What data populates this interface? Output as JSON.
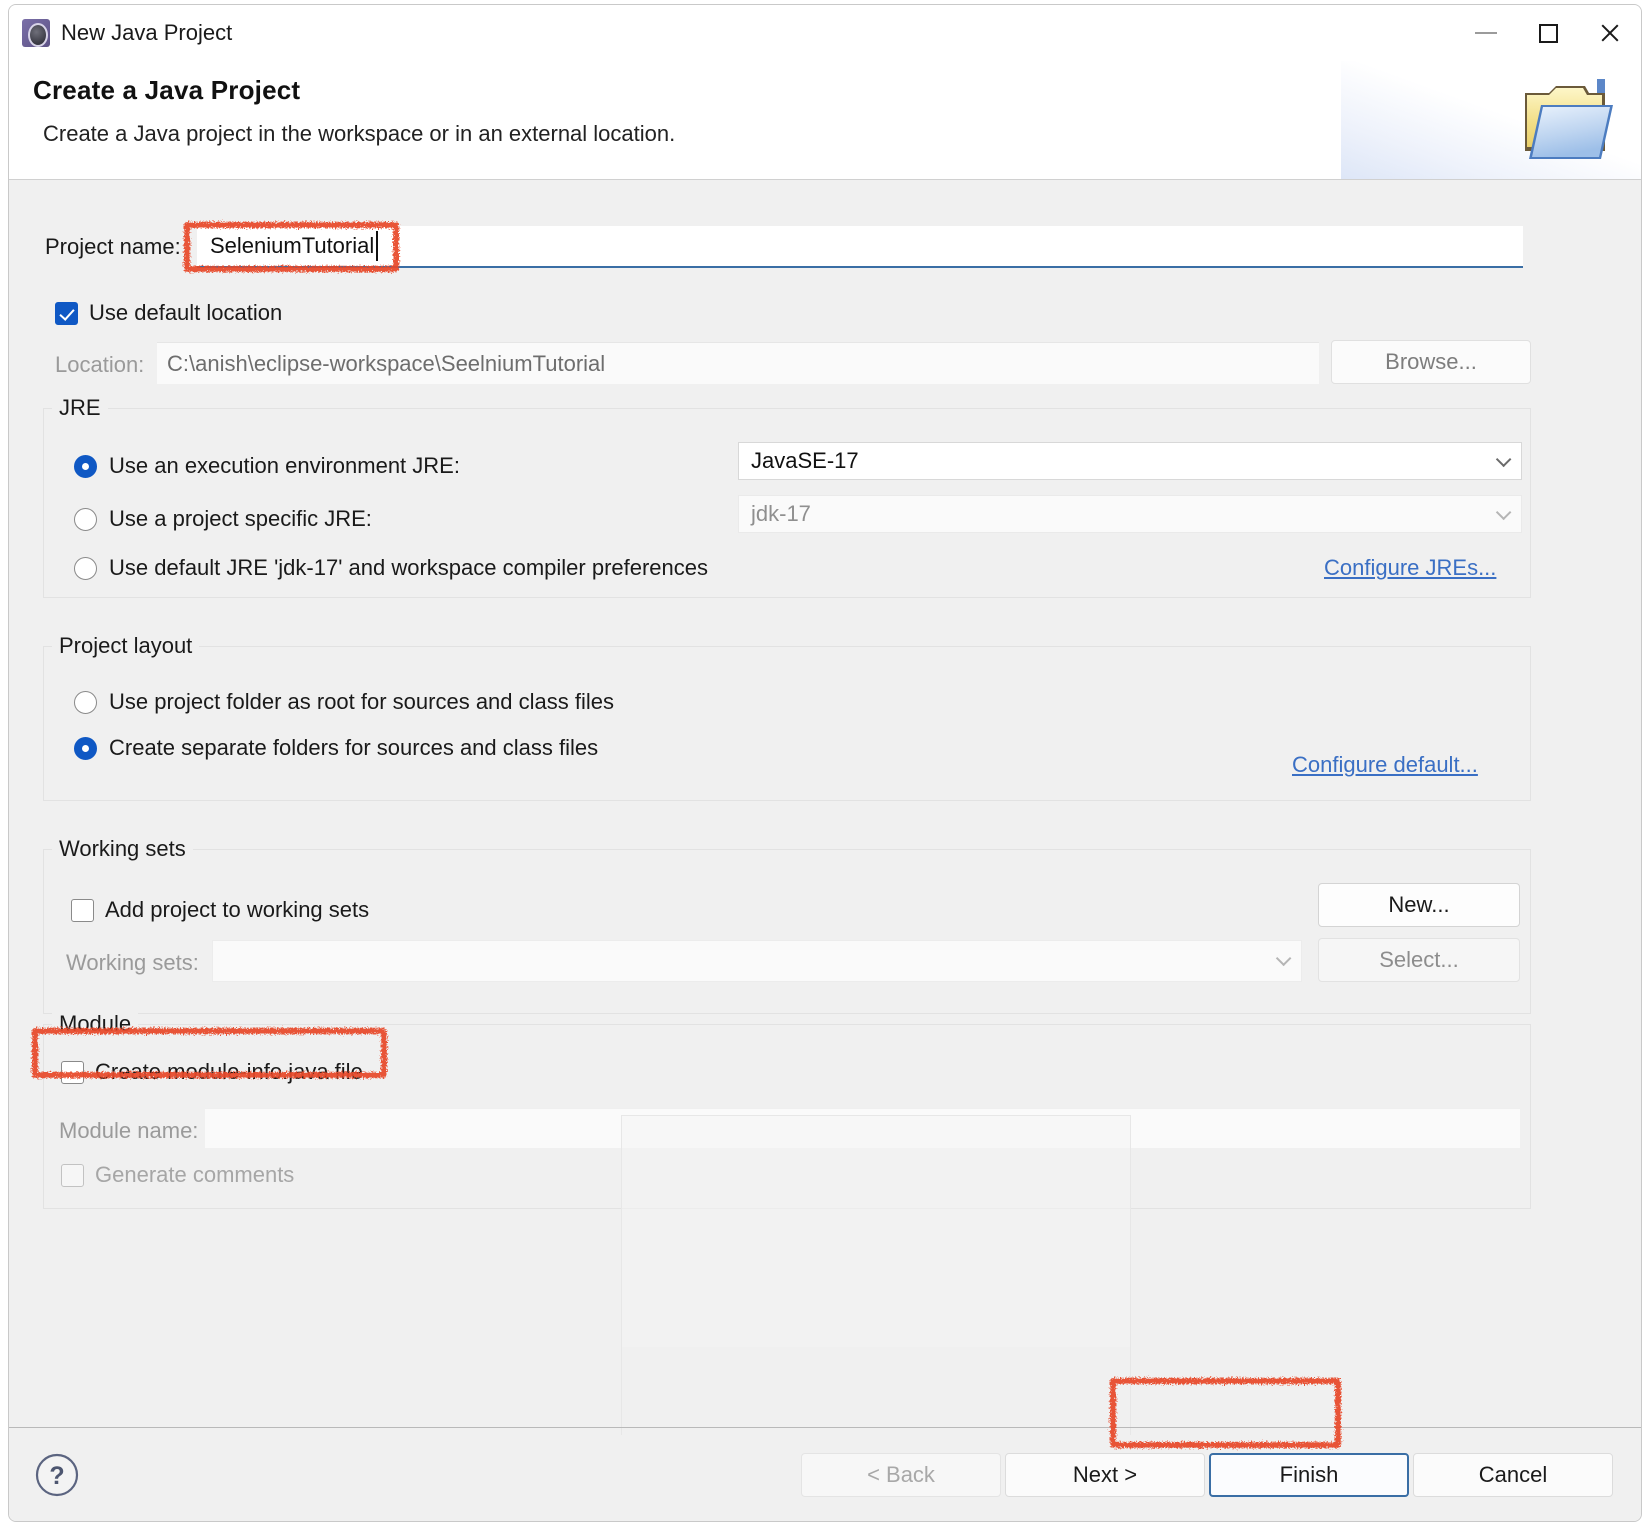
{
  "window": {
    "title": "New Java Project",
    "app_icon": "eclipse-icon",
    "controls": {
      "minimize": "minimize-icon",
      "maximize": "maximize-icon",
      "close": "close-icon"
    }
  },
  "banner": {
    "heading": "Create a Java Project",
    "subtitle": "Create a Java project in the workspace or in an external location.",
    "art_icon": "folder-icon"
  },
  "form": {
    "project_name": {
      "label": "Project name:",
      "value": "SeleniumTutorial",
      "placeholder": ""
    },
    "use_default_location": {
      "label": "Use default location",
      "checked": true
    },
    "location": {
      "label": "Location:",
      "value": "C:\\anish\\eclipse-workspace\\SeelniumTutorial",
      "browse_label": "Browse..."
    }
  },
  "jre": {
    "group_title": "JRE",
    "options": [
      {
        "label": "Use an execution environment JRE:",
        "selected": true
      },
      {
        "label": "Use a project specific JRE:",
        "selected": false
      },
      {
        "label": "Use default JRE 'jdk-17' and workspace compiler preferences",
        "selected": false
      }
    ],
    "execution_env_value": "JavaSE-17",
    "project_jre_value": "jdk-17",
    "configure_link": "Configure JREs..."
  },
  "project_layout": {
    "group_title": "Project layout",
    "options": [
      {
        "label": "Use project folder as root for sources and class files",
        "selected": false
      },
      {
        "label": "Create separate folders for sources and class files",
        "selected": true
      }
    ],
    "configure_link": "Configure default..."
  },
  "working_sets": {
    "group_title": "Working sets",
    "add_checkbox": {
      "label": "Add project to working sets",
      "checked": false
    },
    "new_button": "New...",
    "sets_label": "Working sets:",
    "sets_value": "",
    "select_button": "Select..."
  },
  "module": {
    "group_title": "Module",
    "create_info": {
      "label": "Create module-info.java file",
      "checked": false
    },
    "module_name_label": "Module name:",
    "module_name_value": "",
    "generate_comments": {
      "label": "Generate comments",
      "checked": false
    }
  },
  "footer": {
    "help_icon": "help-icon",
    "buttons": [
      {
        "label": "< Back",
        "state": "disabled"
      },
      {
        "label": "Next >",
        "state": "enabled"
      },
      {
        "label": "Finish",
        "state": "default"
      },
      {
        "label": "Cancel",
        "state": "enabled"
      }
    ]
  },
  "annotations": {
    "color": "#e8492a",
    "targets": [
      "project-name-field",
      "create-module-info-checkbox",
      "finish-button"
    ]
  }
}
